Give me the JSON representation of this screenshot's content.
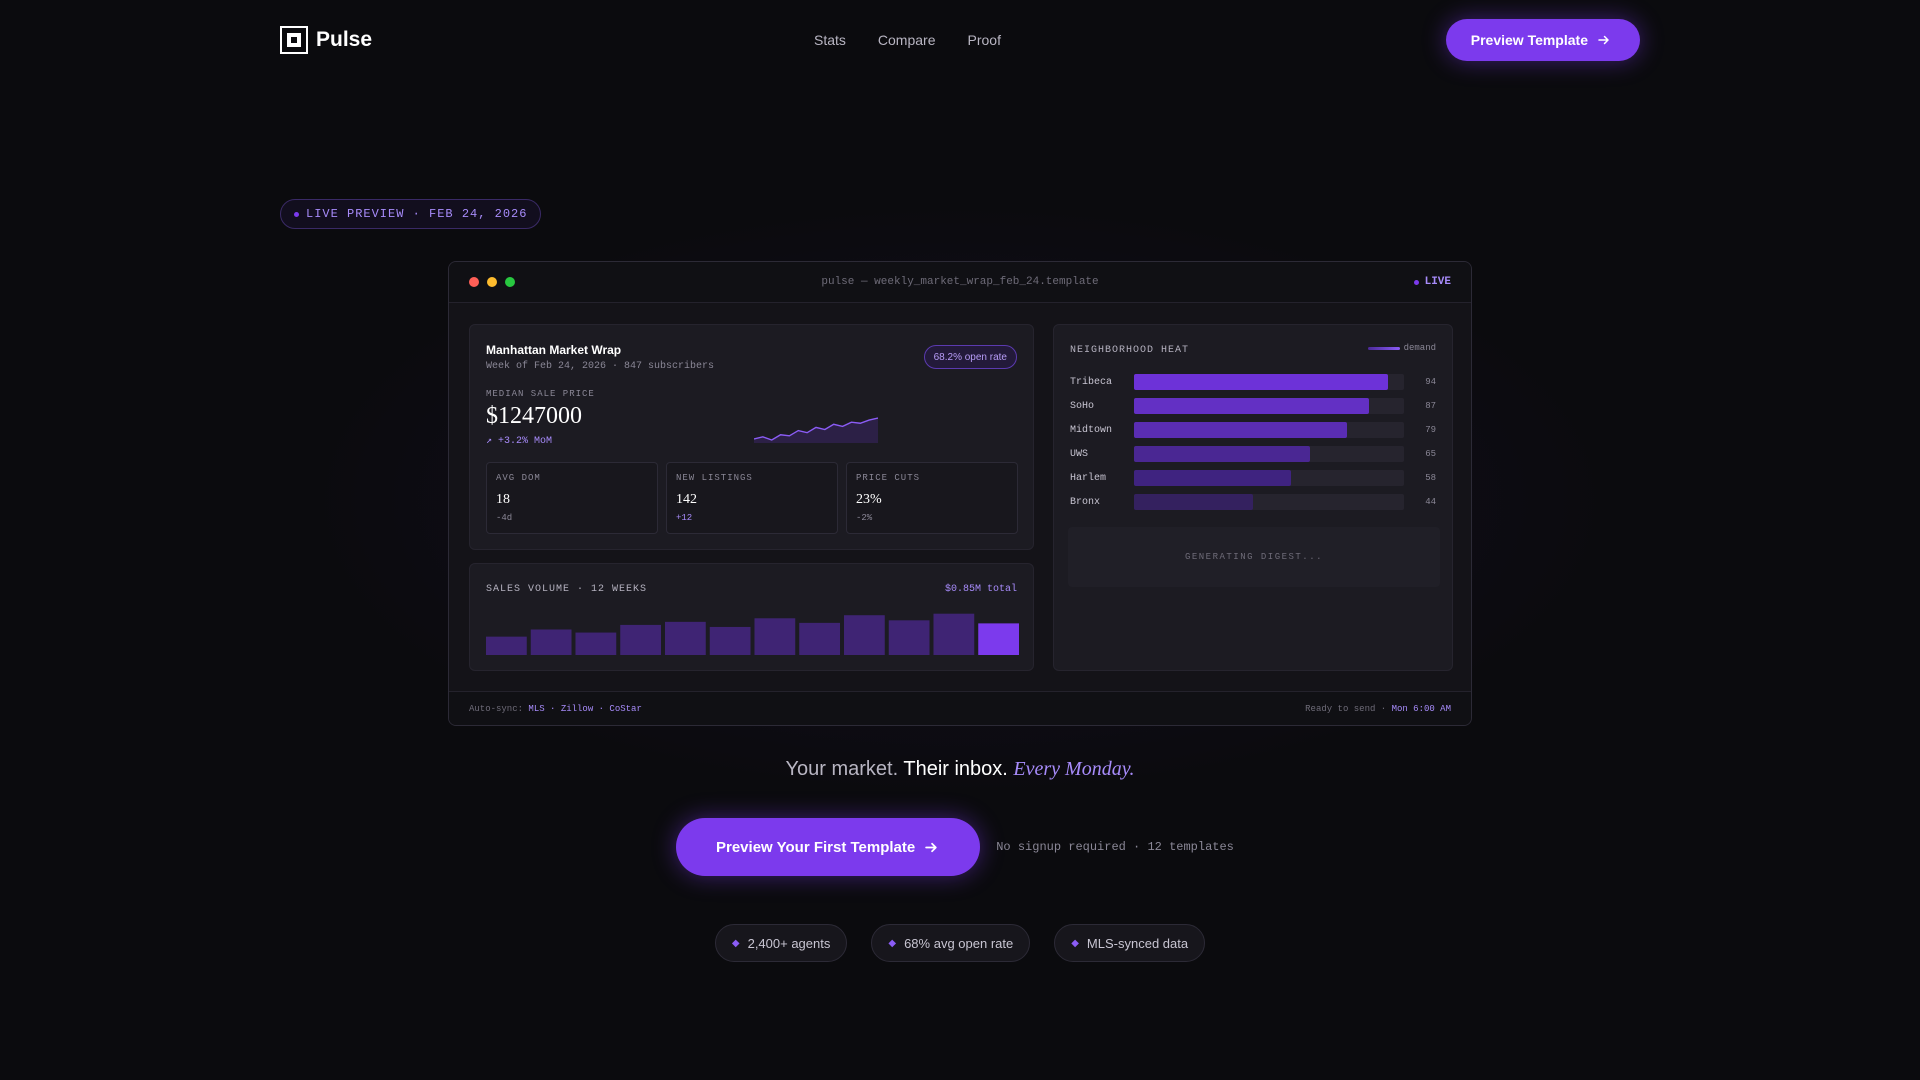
{
  "nav": {
    "brand": "Pulse",
    "links": [
      "Stats",
      "Compare",
      "Proof"
    ],
    "cta": "Preview Template"
  },
  "live_pill": "LIVE PREVIEW · FEB 24, 2026",
  "window": {
    "title": "pulse — weekly_market_wrap_feb_24.template",
    "live_label": "LIVE",
    "market": {
      "title": "Manhattan Market Wrap",
      "subtitle": "Week of Feb 24, 2026 · 847 subscribers",
      "open_rate_badge": "68.2% open rate",
      "median_label": "MEDIAN SALE PRICE",
      "median_value": "$1247000",
      "median_change": "↗ +3.2% MoM",
      "sparkline": [
        10,
        12,
        9,
        14,
        13,
        18,
        16,
        21,
        19,
        24,
        22,
        26,
        25,
        28,
        30
      ],
      "stats": [
        {
          "label": "AVG DOM",
          "value": "18",
          "delta": "-4d",
          "up": false
        },
        {
          "label": "NEW LISTINGS",
          "value": "142",
          "delta": "+12",
          "up": true
        },
        {
          "label": "PRICE CUTS",
          "value": "23%",
          "delta": "-2%",
          "up": false
        }
      ]
    },
    "volume": {
      "title": "SALES VOLUME · 12 WEEKS",
      "total": "$0.85M total",
      "bars": [
        0.36,
        0.5,
        0.44,
        0.59,
        0.65,
        0.55,
        0.72,
        0.63,
        0.78,
        0.68,
        0.81,
        0.62
      ]
    },
    "heat": {
      "title": "NEIGHBORHOOD HEAT",
      "legend": "demand",
      "rows": [
        {
          "name": "Tribeca",
          "value": 94
        },
        {
          "name": "SoHo",
          "value": 87
        },
        {
          "name": "Midtown",
          "value": 79
        },
        {
          "name": "UWS",
          "value": 65
        },
        {
          "name": "Harlem",
          "value": 58
        },
        {
          "name": "Bronx",
          "value": 44
        }
      ],
      "digest": "GENERATING DIGEST..."
    },
    "footer": {
      "sync_prefix": "Auto-sync:",
      "sync_sources": "MLS · Zillow · CoStar",
      "ready_prefix": "Ready to send ·",
      "ready_time": "Mon 6:00 AM"
    }
  },
  "tagline": {
    "part1": "Your market.",
    "part2": "Their inbox.",
    "part3": "Every Monday."
  },
  "cta": {
    "button": "Preview Your First Template",
    "note": "No signup required · 12 templates"
  },
  "chips": [
    "2,400+ agents",
    "68% avg open rate",
    "MLS-synced data"
  ],
  "colors": {
    "accent": "#7c3aed",
    "accent_light": "#a78bfa",
    "background": "#0b0b0e"
  }
}
